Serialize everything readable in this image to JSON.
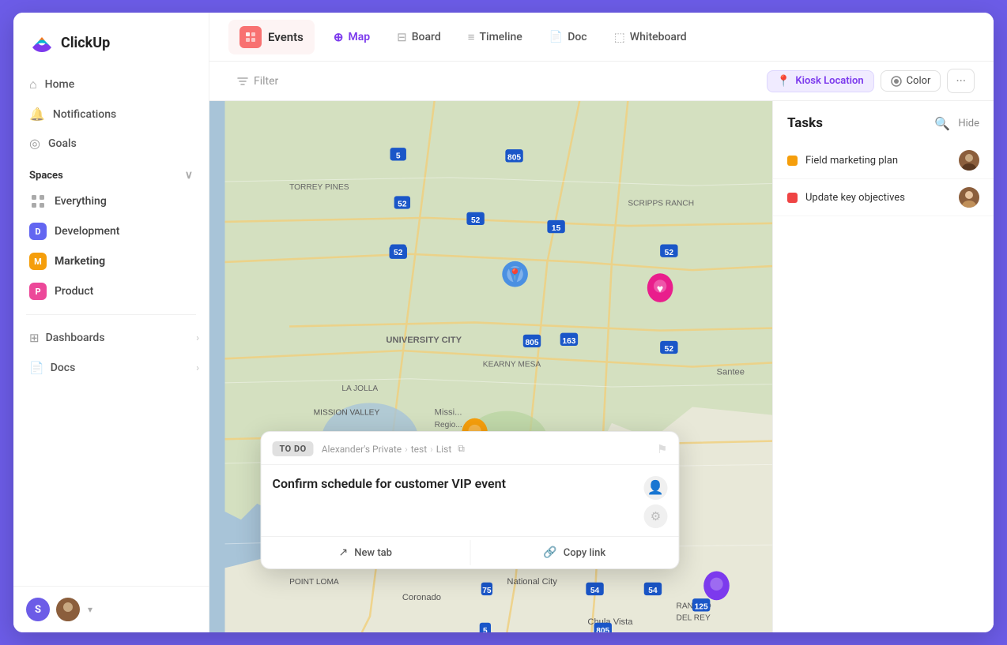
{
  "app": {
    "name": "ClickUp"
  },
  "sidebar": {
    "nav": [
      {
        "id": "home",
        "label": "Home",
        "icon": "🏠"
      },
      {
        "id": "notifications",
        "label": "Notifications",
        "icon": "🔔"
      },
      {
        "id": "goals",
        "label": "Goals",
        "icon": "🎯"
      }
    ],
    "spaces_label": "Spaces",
    "spaces": [
      {
        "id": "everything",
        "label": "Everything",
        "icon": "grid",
        "color": null
      },
      {
        "id": "development",
        "label": "Development",
        "initial": "D",
        "color": "#6366f1"
      },
      {
        "id": "marketing",
        "label": "Marketing",
        "initial": "M",
        "color": "#f59e0b",
        "active": true
      },
      {
        "id": "product",
        "label": "Product",
        "initial": "P",
        "color": "#ec4899"
      }
    ],
    "bottom_items": [
      {
        "id": "dashboards",
        "label": "Dashboards"
      },
      {
        "id": "docs",
        "label": "Docs"
      }
    ],
    "footer": {
      "avatar_initial": "S",
      "avatar_color": "#6c5ce7"
    }
  },
  "top_nav": {
    "current_view": "Events",
    "tabs": [
      {
        "id": "map",
        "label": "Map",
        "icon": "📍",
        "active": true
      },
      {
        "id": "board",
        "label": "Board",
        "icon": "⬜"
      },
      {
        "id": "timeline",
        "label": "Timeline",
        "icon": "—"
      },
      {
        "id": "doc",
        "label": "Doc",
        "icon": "📄"
      },
      {
        "id": "whiteboard",
        "label": "Whiteboard",
        "icon": "⬜"
      }
    ]
  },
  "toolbar": {
    "filter_label": "Filter",
    "kiosk_label": "Kiosk Location",
    "color_label": "Color",
    "more_icon": "···"
  },
  "tasks": {
    "title": "Tasks",
    "hide_label": "Hide",
    "items": [
      {
        "id": "task1",
        "label": "Field marketing plan",
        "color": "#f59e0b",
        "has_avatar": true
      },
      {
        "id": "task2",
        "label": "Update key objectives",
        "color": "#ef4444",
        "has_avatar": true
      }
    ]
  },
  "popup": {
    "status": "TO DO",
    "breadcrumb": [
      "Alexander's Private",
      "test",
      "List"
    ],
    "title": "Confirm schedule for customer VIP event",
    "footer_buttons": [
      {
        "id": "new-tab",
        "label": "New tab",
        "icon": "↗"
      },
      {
        "id": "copy-link",
        "label": "Copy link",
        "icon": "🔗"
      }
    ]
  },
  "map": {
    "center": "San Diego, CA"
  }
}
